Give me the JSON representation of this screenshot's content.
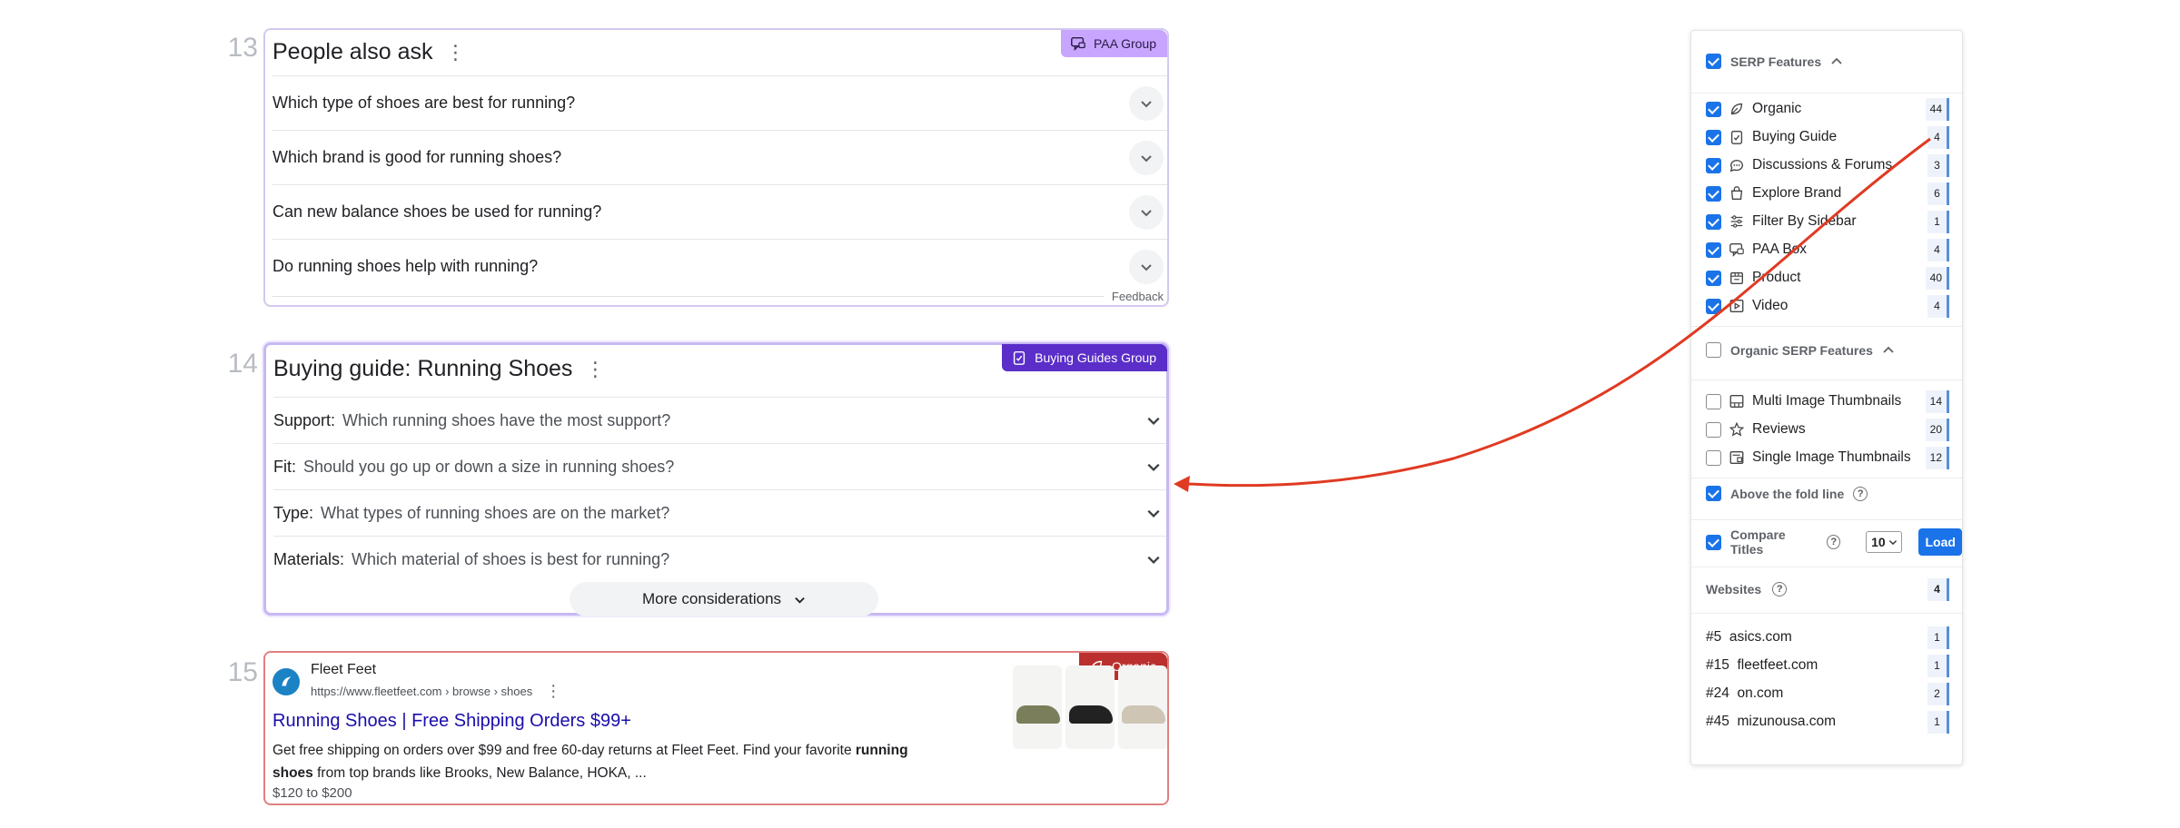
{
  "results": {
    "paa": {
      "rank": "13",
      "title": "People also ask",
      "tag": "PAA Group",
      "questions": [
        "Which type of shoes are best for running?",
        "Which brand is good for running shoes?",
        "Can new balance shoes be used for running?",
        "Do running shoes help with running?"
      ],
      "feedback": "Feedback"
    },
    "buying_guide": {
      "rank": "14",
      "title": "Buying guide: Running Shoes",
      "tag": "Buying Guides Group",
      "rows": [
        {
          "key": "Support:",
          "text": "Which running shoes have the most support?"
        },
        {
          "key": "Fit:",
          "text": "Should you go up or down a size in running shoes?"
        },
        {
          "key": "Type:",
          "text": "What types of running shoes are on the market?"
        },
        {
          "key": "Materials:",
          "text": "Which material of shoes is best for running?"
        }
      ],
      "more": "More considerations"
    },
    "organic": {
      "rank": "15",
      "tag": "Organic",
      "site_name": "Fleet Feet",
      "url": "https://www.fleetfeet.com › browse › shoes",
      "title": "Running Shoes | Free Shipping Orders $99+",
      "snippet_1": "Get free shipping on orders over $99 and free 60-day returns at Fleet Feet. Find your favorite ",
      "snippet_bold_1": "running",
      "snippet_bold_2": "shoes",
      "snippet_2": " from top brands like Brooks, New Balance, HOKA, ...",
      "price": "$120 to $200"
    }
  },
  "sidebar": {
    "serp_features": {
      "label": "SERP Features",
      "items": [
        {
          "label": "Organic",
          "count": "44",
          "icon": "leaf-icon"
        },
        {
          "label": "Buying Guide",
          "count": "4",
          "icon": "clipboard-icon"
        },
        {
          "label": "Discussions & Forums",
          "count": "3",
          "icon": "chat-bubble-icon"
        },
        {
          "label": "Explore Brand",
          "count": "6",
          "icon": "shopping-bag-icon"
        },
        {
          "label": "Filter By Sidebar",
          "count": "1",
          "icon": "filter-sliders-icon"
        },
        {
          "label": "PAA Box",
          "count": "4",
          "icon": "question-chat-icon"
        },
        {
          "label": "Product",
          "count": "40",
          "icon": "product-box-icon"
        },
        {
          "label": "Video",
          "count": "4",
          "icon": "video-play-icon"
        }
      ]
    },
    "organic_serp_features": {
      "label": "Organic SERP Features",
      "items": [
        {
          "label": "Multi Image Thumbnails",
          "count": "14",
          "icon": "multi-image-icon"
        },
        {
          "label": "Reviews",
          "count": "20",
          "icon": "star-icon"
        },
        {
          "label": "Single Image Thumbnails",
          "count": "12",
          "icon": "single-image-icon"
        }
      ]
    },
    "above_fold": "Above the fold line",
    "compare_titles": "Compare Titles",
    "compare_value": "10",
    "load": "Load",
    "websites": {
      "label": "Websites",
      "count": "4",
      "items": [
        {
          "rank": "#5",
          "domain": "asics.com",
          "count": "1"
        },
        {
          "rank": "#15",
          "domain": "fleetfeet.com",
          "count": "1"
        },
        {
          "rank": "#24",
          "domain": "on.com",
          "count": "2"
        },
        {
          "rank": "#45",
          "domain": "mizunousa.com",
          "count": "1"
        }
      ]
    }
  },
  "colors": {
    "paa_tag": "#c8a6ff",
    "buying_guide_tag": "#5b2ec9",
    "organic_tag": "#b9302f",
    "accent_blue": "#1a73e8",
    "annotation_arrow": "#e03a22"
  }
}
